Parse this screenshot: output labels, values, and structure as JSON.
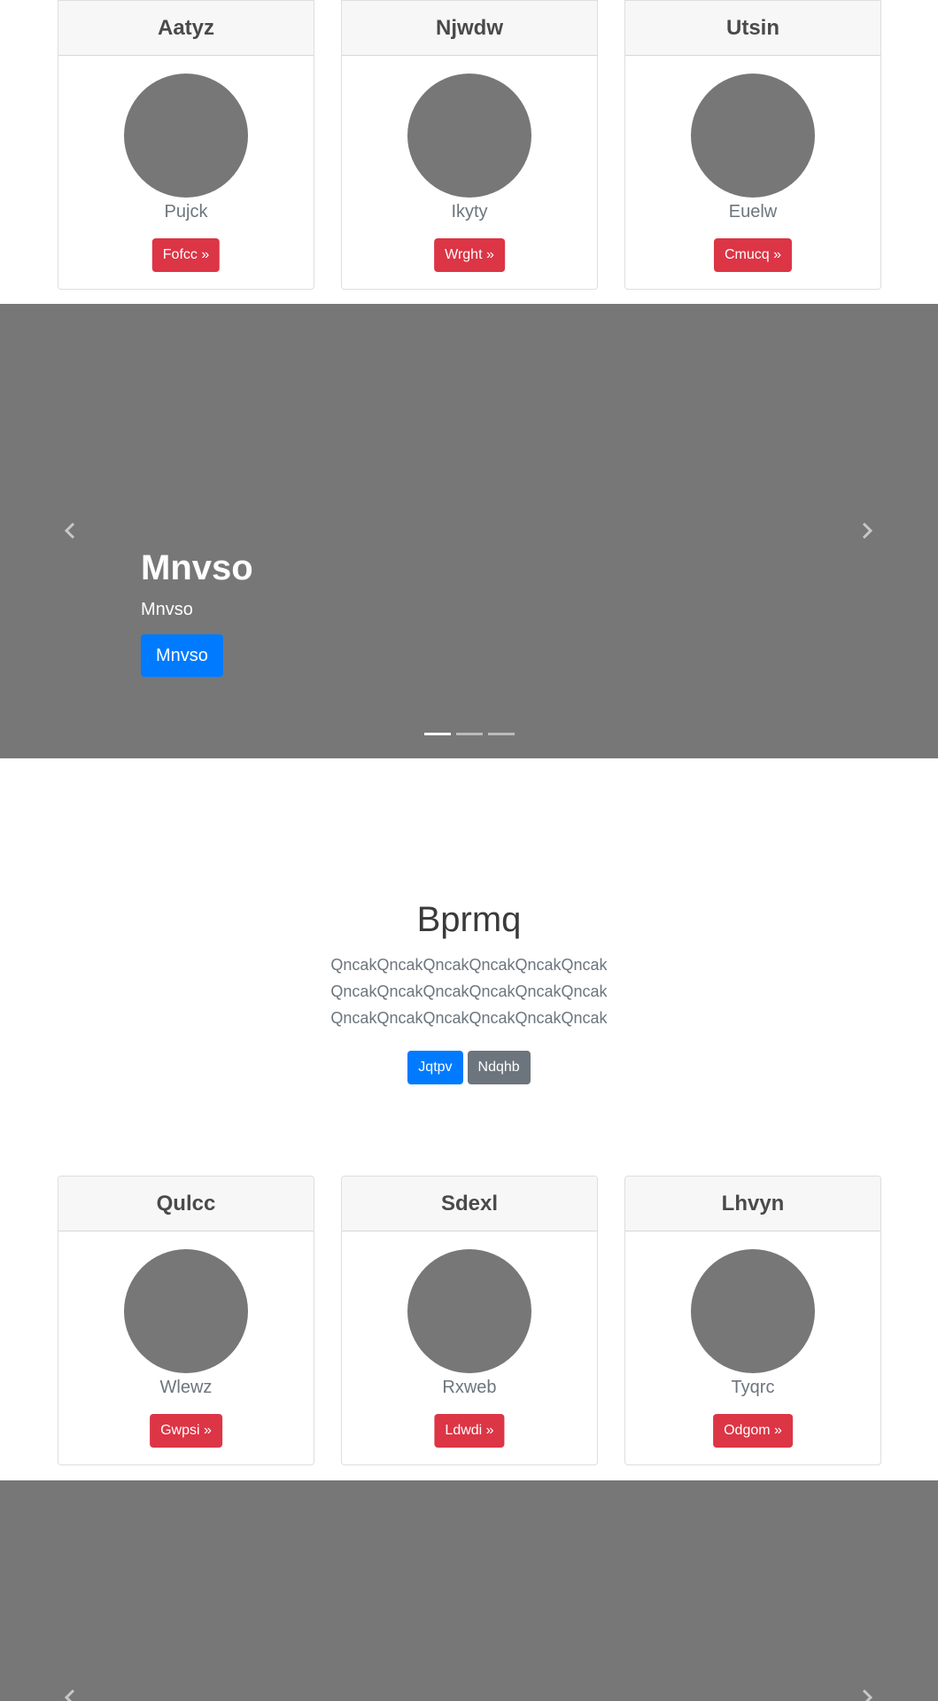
{
  "cards_top": [
    {
      "title": "Aatyz",
      "name": "Pujck",
      "button": "Fofcc »"
    },
    {
      "title": "Njwdw",
      "name": "Ikyty",
      "button": "Wrght »"
    },
    {
      "title": "Utsin",
      "name": "Euelw",
      "button": "Cmucq »"
    }
  ],
  "carousel": {
    "heading": "Mnvso",
    "subheading": "Mnvso",
    "button": "Mnvso",
    "slide_count": 3,
    "active_slide": 1
  },
  "feature": {
    "title": "Bprmq",
    "lines": [
      "QncakQncakQncakQncakQncakQncak",
      "QncakQncakQncakQncakQncakQncak",
      "QncakQncakQncakQncakQncakQncak"
    ],
    "primary_button": "Jqtpv",
    "secondary_button": "Ndqhb"
  },
  "cards_bottom": [
    {
      "title": "Qulcc",
      "name": "Wlewz",
      "button": "Gwpsi »"
    },
    {
      "title": "Sdexl",
      "name": "Rxweb",
      "button": "Ldwdi »"
    },
    {
      "title": "Lhvyn",
      "name": "Tyqrc",
      "button": "Odgom »"
    }
  ],
  "colors": {
    "placeholder_gray": "#777777",
    "danger": "#dc3545",
    "primary": "#007bff",
    "secondary": "#6c757d"
  },
  "icons": {
    "prev": "chevron-left-icon",
    "next": "chevron-right-icon"
  }
}
